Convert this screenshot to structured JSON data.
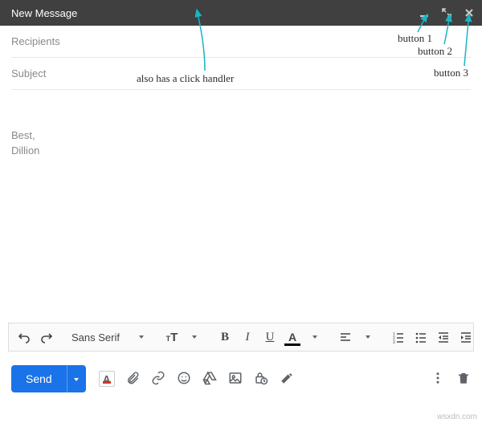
{
  "header": {
    "title": "New Message"
  },
  "fields": {
    "recipients_label": "Recipients",
    "subject_label": "Subject"
  },
  "body": {
    "line1": "Best,",
    "line2": "Dillion"
  },
  "toolbar": {
    "font": "Sans Serif"
  },
  "bottom": {
    "send_label": "Send"
  },
  "annotations": {
    "click_handler": "also has a click handler",
    "btn1": "button 1",
    "btn2": "button 2",
    "btn3": "button 3"
  },
  "watermark": "wsxdn.com"
}
